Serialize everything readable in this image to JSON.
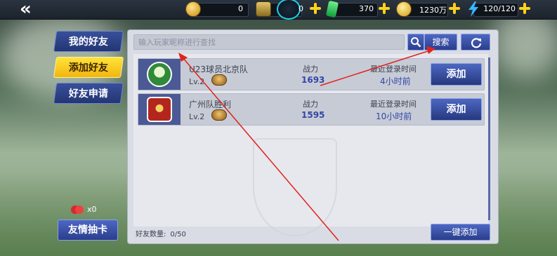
{
  "topbar": {
    "back_label": "«",
    "resources": [
      {
        "name": "gold",
        "value": "0"
      },
      {
        "name": "shield",
        "value": "0"
      },
      {
        "name": "gem",
        "value": "370"
      },
      {
        "name": "coin",
        "value": "1230万"
      },
      {
        "name": "energy",
        "value": "120/120"
      }
    ]
  },
  "sidebar": {
    "tabs": [
      {
        "label": "我的好友",
        "active": false
      },
      {
        "label": "添加好友",
        "active": true
      },
      {
        "label": "好友申请",
        "active": false
      }
    ],
    "gift_count": "x0",
    "draw_button": "友情抽卡"
  },
  "search": {
    "placeholder": "输入玩家昵称进行查找",
    "search_button": "搜索"
  },
  "list": {
    "power_label": "战力",
    "login_label": "最近登录时间",
    "add_label": "添加",
    "rows": [
      {
        "name": "U23球员北京队",
        "level": "Lv.2",
        "power": "1693",
        "last_login": "4小时前",
        "badge_color": "#2f8a3a"
      },
      {
        "name": "广州队胜利",
        "level": "Lv.2",
        "power": "1595",
        "last_login": "10小时前",
        "badge_color": "#b3261e"
      }
    ]
  },
  "footer": {
    "friend_count_label": "好友数量:",
    "friend_count_value": "0/50",
    "one_key_add": "一键添加"
  },
  "colors": {
    "accent_yellow": "#ffd21a",
    "primary_blue": "#3146a6",
    "annotation_red": "#e3221c"
  }
}
